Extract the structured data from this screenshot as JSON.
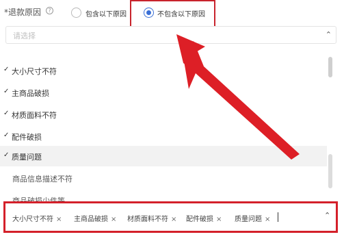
{
  "filter": {
    "label": "*退款原因",
    "help_icon": "?",
    "radio_include_label": "包含以下原因",
    "radio_exclude_label": "不包含以下原因",
    "selected": "exclude"
  },
  "select": {
    "placeholder": "请选择",
    "options": [
      {
        "label": "大小尺寸不符",
        "checked": true
      },
      {
        "label": "主商品破损",
        "checked": true
      },
      {
        "label": "材质面料不符",
        "checked": true
      },
      {
        "label": "配件破损",
        "checked": true
      },
      {
        "label": "质量问题",
        "checked": true
      },
      {
        "label": "商品信息描述不符",
        "checked": false
      },
      {
        "label": "商品破损少件等",
        "checked": false
      }
    ],
    "check_mark": "✓",
    "tags": [
      "大小尺寸不符",
      "主商品破损",
      "材质面料不符",
      "配件破损",
      "质量问题"
    ],
    "tag_remove": "×",
    "chevron_down": "⌄",
    "chevron_up": "⌃"
  },
  "colors": {
    "accent": "#3a6fd6",
    "highlight": "#d4202a"
  }
}
